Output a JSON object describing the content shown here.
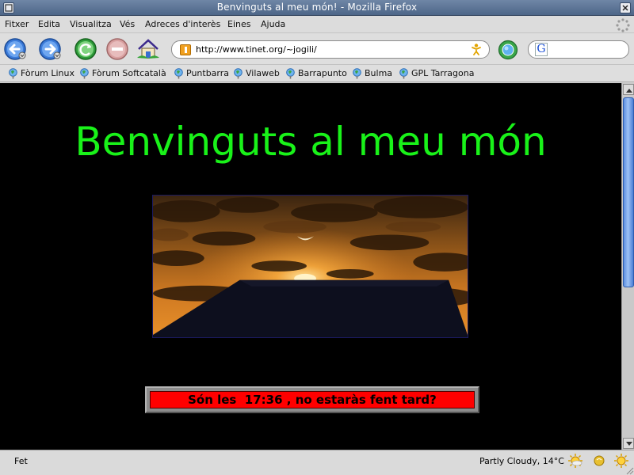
{
  "window": {
    "title": "Benvinguts al meu món! - Mozilla Firefox"
  },
  "menubar": {
    "items": [
      "Fitxer",
      "Edita",
      "Visualitza",
      "Vés",
      "Adreces d'interès",
      "Eines",
      "Ajuda"
    ]
  },
  "navbar": {
    "url": "http://www.tinet.org/~jogili/",
    "search_value": ""
  },
  "bookmarks": [
    "Fòrum Linux",
    "Fòrum Softcatalà",
    "Puntbarra",
    "Vilaweb",
    "Barrapunto",
    "Bulma",
    "GPL Tarragona"
  ],
  "page": {
    "heading": "Benvinguts al meu món",
    "clock_text": "Són les  17:36 , no estaràs fent tard?"
  },
  "statusbar": {
    "status": "Fet",
    "weather": "Partly Cloudy, 14°C"
  },
  "colors": {
    "heading": "#19f219",
    "page_background": "#000000",
    "clock_background": "#ff0000"
  }
}
